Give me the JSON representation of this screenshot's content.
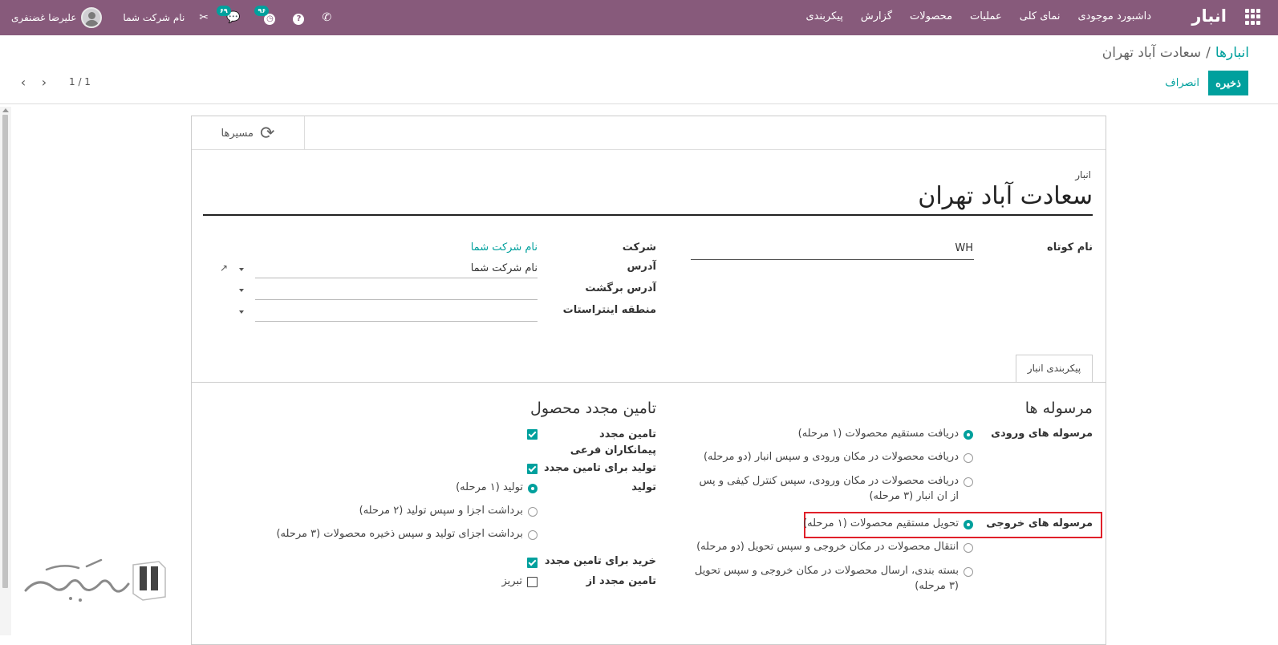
{
  "navbar": {
    "brand": "انبار",
    "menu": [
      "داشبورد موجودی",
      "نمای کلی",
      "عملیات",
      "محصولات",
      "گزارش",
      "پیکربندی"
    ],
    "company": "نام شرکت شما",
    "user": "علیرضا غضنفری",
    "messages_count": "۶۹",
    "activities_count": "۹۶",
    "help_icon": "?",
    "colors": {
      "navbar": "#875a7b",
      "accent": "#00a09d"
    }
  },
  "control": {
    "breadcrumb_parent": "انبارها",
    "breadcrumb_sep": "/",
    "breadcrumb_current": "سعادت آباد تهران",
    "save_label": "ذخیره",
    "discard_label": "انصراف",
    "pager": "1 / 1"
  },
  "form": {
    "routes_button": "مسیرها",
    "warehouse_label": "انبار",
    "warehouse_name": "سعادت آباد تهران",
    "short_name_label": "نام کوتاه",
    "short_name_value": "WH",
    "company_label": "شرکت",
    "company_value": "نام شرکت شما",
    "address_label": "آدرس",
    "address_value": "نام شرکت شما",
    "return_address_label": "آدرس برگشت",
    "return_address_value": "",
    "intrastat_label": "منطقه اینتراستات",
    "intrastat_value": ""
  },
  "tabs": {
    "config": "پیکربندی انبار"
  },
  "shipments": {
    "title": "مرسوله ها",
    "incoming_label": "مرسوله های ورودی",
    "incoming_options": [
      "دریافت مستقیم محصولات (۱ مرحله)",
      "دریافت محصولات در مکان ورودی و سپس انبار (دو مرحله)",
      "دریافت محصولات در مکان ورودی، سپس کنترل کیفی و پس از ان انبار (۳ مرحله)"
    ],
    "outgoing_label": "مرسوله های خروجی",
    "outgoing_options": [
      "تحویل مستقیم محصولات (۱ مرحله)",
      "انتقال محصولات در مکان خروجی و سپس تحویل (دو مرحله)",
      "بسته بندی، ارسال محصولات در مکان خروجی و سپس تحویل (۳ مرحله)"
    ]
  },
  "resupply": {
    "title": "تامین مجدد محصول",
    "subcontract_label": "تامین مجدد پیمانکاران فرعی",
    "manufacture_label": "تولید برای تامین مجدد",
    "manufacture_steps_label": "تولید",
    "manufacture_options": [
      "تولید (۱ مرحله)",
      "برداشت اجزا و سپس تولید (۲ مرحله)",
      "برداشت اجزای تولید و سپس ذخیره محصولات (۳ مرحله)"
    ],
    "buy_label": "خرید برای تامین مجدد",
    "resupply_from_label": "تامین مجدد از",
    "resupply_from_option": "تبریز"
  }
}
